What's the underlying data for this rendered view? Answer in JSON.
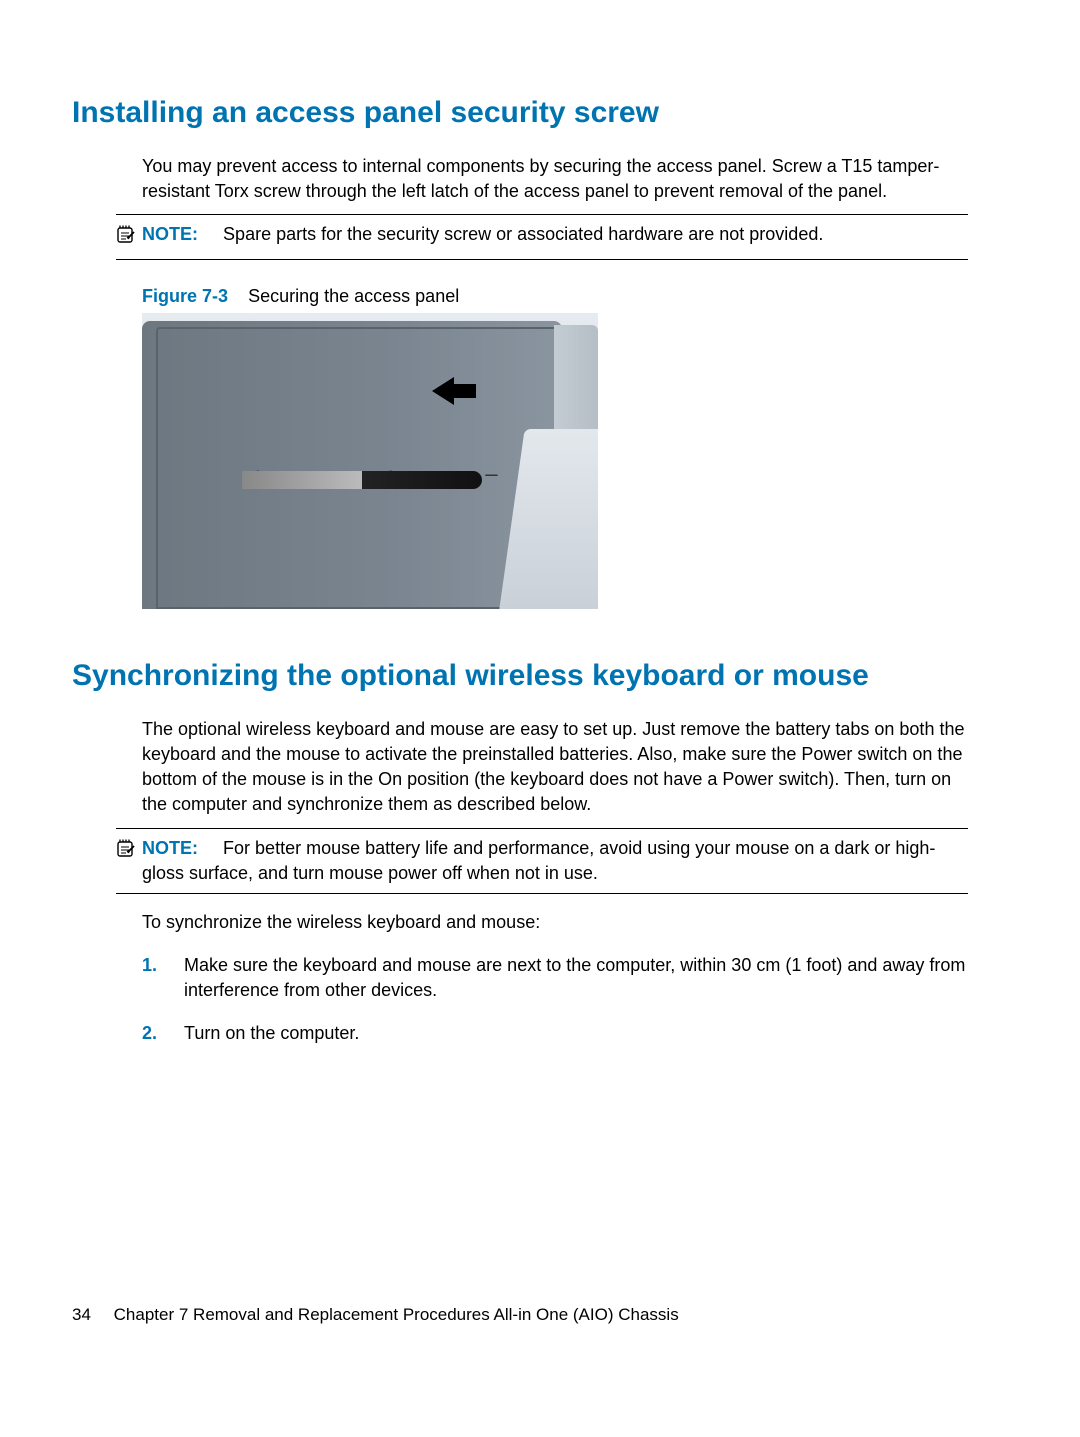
{
  "sections": {
    "s1": {
      "heading": "Installing an access panel security screw",
      "para": "You may prevent access to internal components by securing the access panel. Screw a T15 tamper-resistant Torx screw through the left latch of the access panel to prevent removal of the panel.",
      "note_label": "NOTE:",
      "note_text": "Spare parts for the security screw or associated hardware are not provided.",
      "figure_num": "Figure 7-3",
      "figure_caption": "Securing the access panel"
    },
    "s2": {
      "heading": "Synchronizing the optional wireless keyboard or mouse",
      "para": "The optional wireless keyboard and mouse are easy to set up. Just remove the battery tabs on both the keyboard and the mouse to activate the preinstalled batteries. Also, make sure the Power switch on the bottom of the mouse is in the On position (the keyboard does not have a Power switch). Then, turn on the computer and synchronize them as described below.",
      "note_label": "NOTE:",
      "note_text": "For better mouse battery life and performance, avoid using your mouse on a dark or high-gloss surface, and turn mouse power off when not in use.",
      "intro": "To synchronize the wireless keyboard and mouse:",
      "steps": [
        {
          "num": "1.",
          "text": "Make sure the keyboard and mouse are next to the computer, within 30 cm (1 foot) and away from interference from other devices."
        },
        {
          "num": "2.",
          "text": "Turn on the computer."
        }
      ]
    }
  },
  "footer": {
    "page": "34",
    "chapter": "Chapter 7   Removal and Replacement Procedures All-in One (AIO) Chassis"
  }
}
